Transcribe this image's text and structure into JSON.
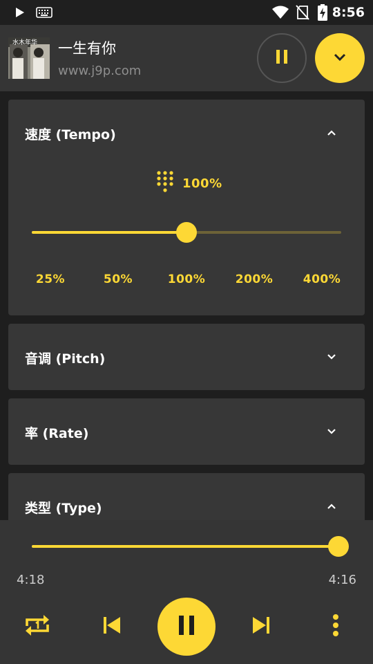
{
  "status_bar": {
    "time": "8:56",
    "icons": [
      "play-icon",
      "keyboard-icon",
      "wifi-icon",
      "no-sim-icon",
      "battery-charging-icon"
    ]
  },
  "now_playing": {
    "title": "一生有你",
    "subtitle": "www.j9p.com",
    "album_art_text": "水木年华",
    "pause_icon": "pause-icon",
    "collapse_icon": "chevron-down-icon"
  },
  "tempo": {
    "title": "速度 (Tempo)",
    "value_label": "100%",
    "slider_fraction": 0.5,
    "presets": [
      "25%",
      "50%",
      "100%",
      "200%",
      "400%"
    ],
    "expanded": true
  },
  "pitch": {
    "title": "音调 (Pitch)",
    "expanded": false
  },
  "rate": {
    "title": "率 (Rate)",
    "expanded": false
  },
  "type": {
    "title": "类型 (Type)",
    "expanded": true
  },
  "player": {
    "elapsed": "4:18",
    "total": "4:16",
    "progress_fraction": 1.0,
    "icons": [
      "repeat-one-icon",
      "skip-previous-icon",
      "pause-icon",
      "skip-next-icon",
      "more-vert-icon"
    ]
  },
  "colors": {
    "accent": "#fdd835",
    "card": "#373737",
    "header": "#353535",
    "background": "#1e1e1e"
  }
}
